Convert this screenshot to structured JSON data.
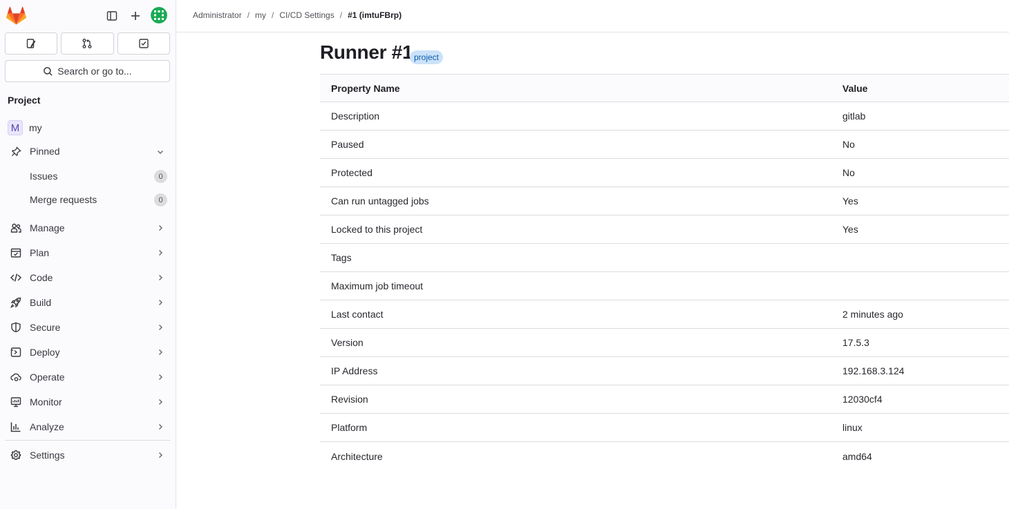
{
  "sidebar": {
    "search_label": "Search or go to...",
    "section_title": "Project",
    "project_name": "my",
    "project_initial": "M",
    "pinned_label": "Pinned",
    "pinned_items": [
      {
        "label": "Issues",
        "count": "0"
      },
      {
        "label": "Merge requests",
        "count": "0"
      }
    ],
    "items": [
      {
        "label": "Manage",
        "icon": "users-icon"
      },
      {
        "label": "Plan",
        "icon": "calendar-icon"
      },
      {
        "label": "Code",
        "icon": "code-icon"
      },
      {
        "label": "Build",
        "icon": "rocket-icon"
      },
      {
        "label": "Secure",
        "icon": "shield-icon"
      },
      {
        "label": "Deploy",
        "icon": "deploy-icon"
      },
      {
        "label": "Operate",
        "icon": "cloud-gear-icon"
      },
      {
        "label": "Monitor",
        "icon": "monitor-icon"
      },
      {
        "label": "Analyze",
        "icon": "chart-icon"
      }
    ],
    "settings_label": "Settings"
  },
  "breadcrumb": [
    "Administrator",
    "my",
    "CI/CD Settings",
    "#1 (imtuFBrp)"
  ],
  "page": {
    "title": "Runner #1",
    "badge": "project"
  },
  "table": {
    "headers": [
      "Property Name",
      "Value"
    ],
    "rows": [
      [
        "Description",
        "gitlab"
      ],
      [
        "Paused",
        "No"
      ],
      [
        "Protected",
        "No"
      ],
      [
        "Can run untagged jobs",
        "Yes"
      ],
      [
        "Locked to this project",
        "Yes"
      ],
      [
        "Tags",
        ""
      ],
      [
        "Maximum job timeout",
        ""
      ],
      [
        "Last contact",
        "2 minutes ago"
      ],
      [
        "Version",
        "17.5.3"
      ],
      [
        "IP Address",
        "192.168.3.124"
      ],
      [
        "Revision",
        "12030cf4"
      ],
      [
        "Platform",
        "linux"
      ],
      [
        "Architecture",
        "amd64"
      ]
    ]
  },
  "colors": {
    "accent": "#fc6d26",
    "badge_bg": "#cbe2f9",
    "badge_text": "#0b5cad"
  }
}
